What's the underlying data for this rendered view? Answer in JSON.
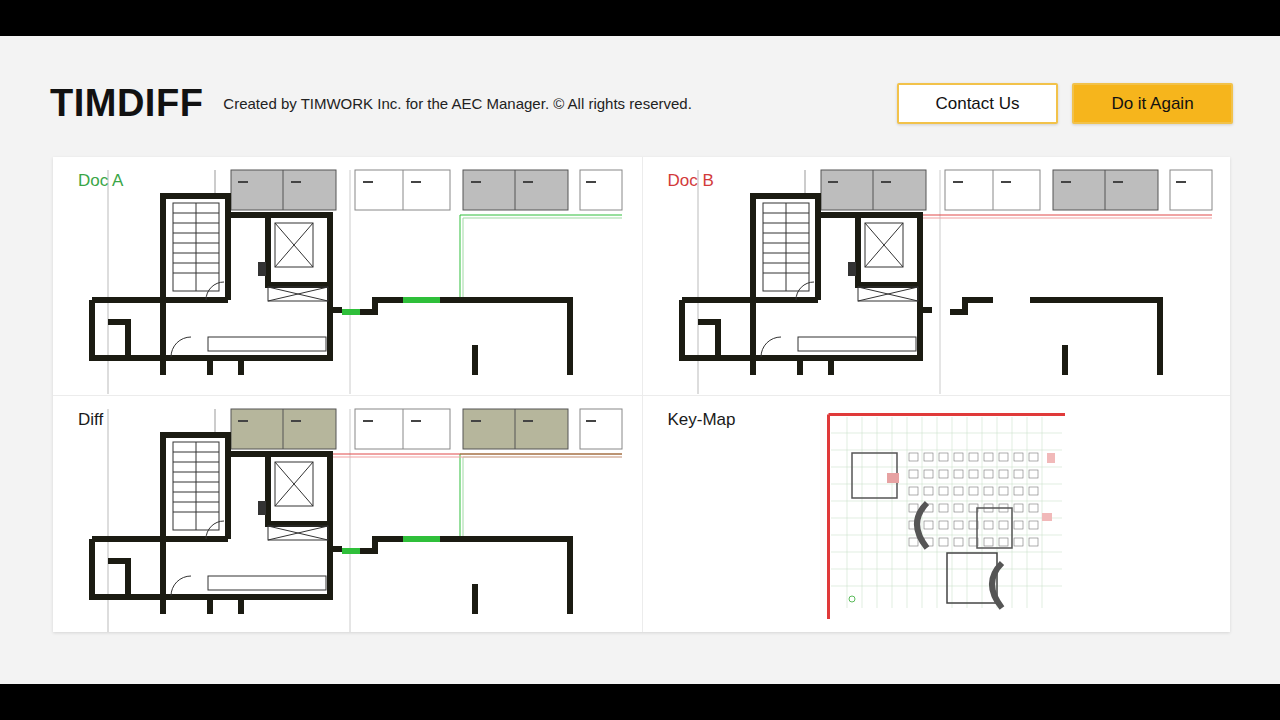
{
  "header": {
    "logo": "TIMDIFF",
    "tagline": "Created by TIMWORK Inc. for the AEC Manager. © All rights reserved.",
    "buttons": [
      {
        "label": "Contact Us",
        "kind": "outline"
      },
      {
        "label": "Do it Again",
        "kind": "primary"
      }
    ]
  },
  "panels": [
    {
      "label": "Doc A",
      "color": "#3aa647",
      "kind": "doc-a"
    },
    {
      "label": "Doc B",
      "color": "#d23a3a",
      "kind": "doc-b"
    },
    {
      "label": "Diff",
      "color": "#1a1a1a",
      "kind": "diff"
    },
    {
      "label": "Key-Map",
      "color": "#1a1a1a",
      "kind": "key-map"
    }
  ]
}
